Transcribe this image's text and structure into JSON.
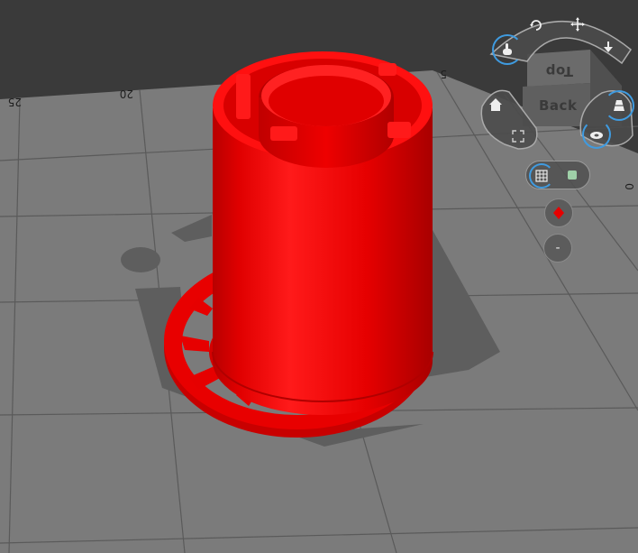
{
  "app": {
    "view": "3D print preview viewport"
  },
  "ruler": {
    "labels": [
      "25",
      "20",
      "5",
      "0"
    ]
  },
  "model": {
    "color": "#e60000",
    "name_visible": ""
  },
  "view_cube": {
    "top_label": "Top",
    "front_label": "Back"
  },
  "nav_controls": {
    "rotate": "rotate-icon",
    "pan": "pan-move-icon",
    "hand": "hand-pointer-icon",
    "down": "arrow-down-icon",
    "home": "home-icon",
    "fit": "fit-to-screen-icon",
    "perspective": "perspective-icon",
    "orthographic": "orthographic-icon",
    "grid_view": "grid-icon",
    "solid_view": "solid-cube-icon",
    "object_color": "red-diamond-icon",
    "minus_label": "-"
  },
  "colors": {
    "grid_floor": "#7a7a7a",
    "background": "#3a3a3a",
    "accent_blue": "#3f9be0",
    "model_red": "#e60000"
  }
}
